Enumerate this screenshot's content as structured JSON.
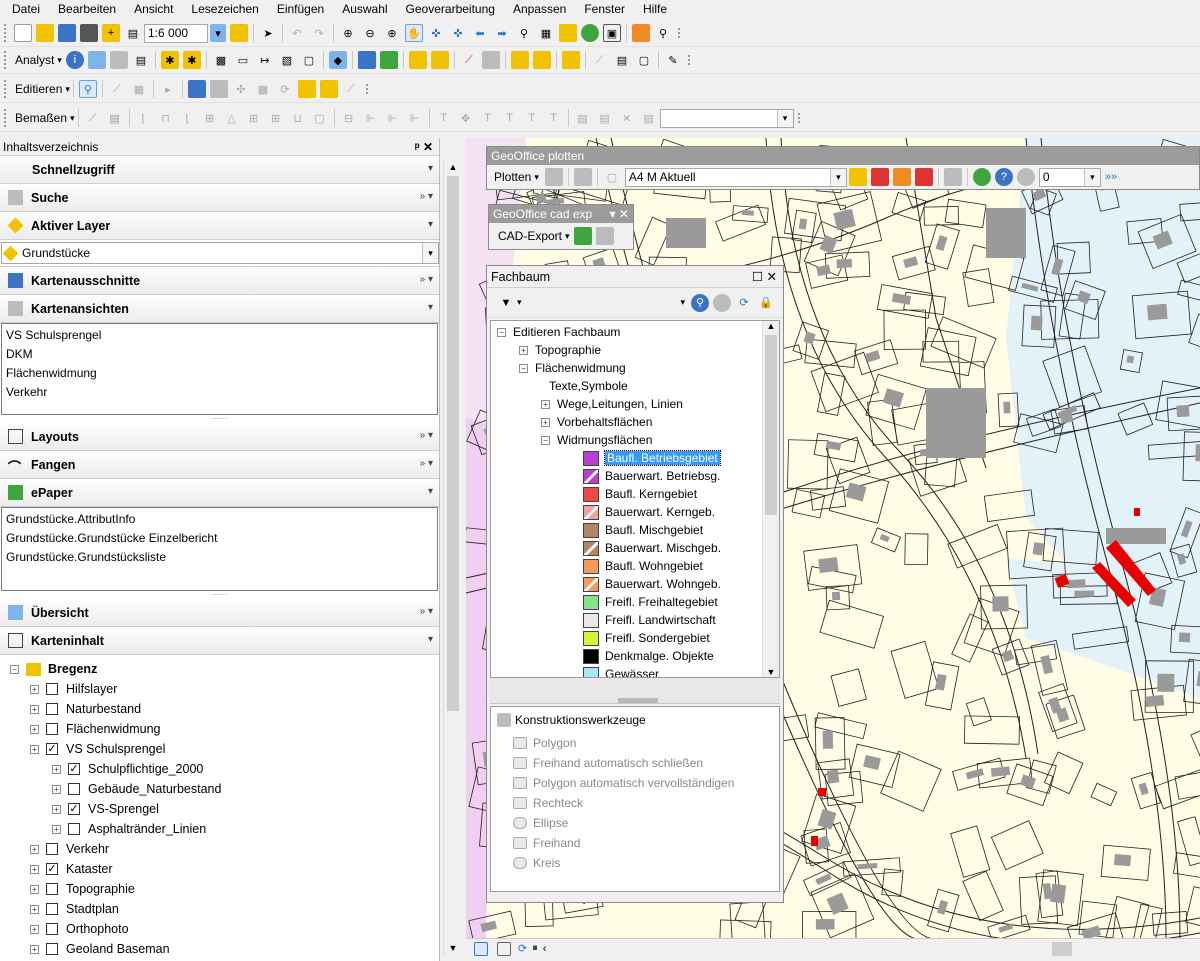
{
  "menu": [
    "Datei",
    "Bearbeiten",
    "Ansicht",
    "Lesezeichen",
    "Einfügen",
    "Auswahl",
    "Geoverarbeitung",
    "Anpassen",
    "Fenster",
    "Hilfe"
  ],
  "toolbar": {
    "scale": "1:6 000",
    "analyst": "Analyst",
    "editieren": "Editieren",
    "bemassen": "Bemaßen"
  },
  "toc": {
    "title": "Inhaltsverzeichnis",
    "pin": "ᵖ ✕",
    "schnellzugriff": "Schnellzugriff",
    "suche": "Suche",
    "aktiver_layer": "Aktiver Layer",
    "aktiver_layer_value": "Grundstücke",
    "kartenausschnitte": "Kartenausschnitte",
    "kartenansichten": "Kartenansichten",
    "kartenansichten_items": [
      "VS Schulsprengel",
      "DKM",
      "Flächenwidmung",
      "Verkehr"
    ],
    "layouts": "Layouts",
    "fangen": "Fangen",
    "epaper": "ePaper",
    "epaper_items": [
      "Grundstücke.AttributInfo",
      "Grundstücke.Grundstücke Einzelbericht",
      "Grundstücke.Grundstücksliste"
    ],
    "uebersicht": "Übersicht",
    "karteninhalt": "Karteninhalt",
    "root_layer": "Bregenz",
    "layers": [
      {
        "label": "Hilfslayer",
        "checked": "",
        "indent": 1
      },
      {
        "label": "Naturbestand",
        "checked": "",
        "indent": 1
      },
      {
        "label": "Flächenwidmung",
        "checked": "",
        "indent": 1
      },
      {
        "label": "VS Schulsprengel",
        "checked": "✓",
        "indent": 1
      },
      {
        "label": "Schulpflichtige_2000",
        "checked": "✓",
        "indent": 2
      },
      {
        "label": "Gebäude_Naturbestand",
        "checked": "",
        "indent": 2
      },
      {
        "label": "VS-Sprengel",
        "checked": "✓",
        "indent": 2
      },
      {
        "label": "Asphaltränder_Linien",
        "checked": "",
        "indent": 2
      },
      {
        "label": "Verkehr",
        "checked": "",
        "indent": 1
      },
      {
        "label": "Kataster",
        "checked": "✓",
        "indent": 1
      },
      {
        "label": "Topographie",
        "checked": "",
        "indent": 1
      },
      {
        "label": "Stadtplan",
        "checked": "",
        "indent": 1
      },
      {
        "label": "Orthophoto",
        "checked": "",
        "indent": 1
      },
      {
        "label": "Geoland Baseman",
        "checked": "",
        "indent": 1
      }
    ]
  },
  "plot": {
    "title": "GeoOffice plotten",
    "plotten": "Plotten",
    "format": "A4 M Aktuell",
    "value": "0"
  },
  "cad": {
    "title": "GeoOffice cad exp",
    "btn": "CAD-Export"
  },
  "fach": {
    "title": "Fachbaum",
    "root": "Editieren Fachbaum",
    "nodes": [
      "Topographie",
      "Flächenwidmung",
      "Texte,Symbole",
      "Wege,Leitungen, Linien",
      "Vorbehaltsflächen",
      "Widmungsflächen"
    ],
    "items": [
      {
        "label": "Baufl. Betriebsgebiet",
        "color": "#b63fd6",
        "hatch": "none",
        "selected": "yes"
      },
      {
        "label": "Bauerwart. Betriebsg.",
        "color": "#b63fd6",
        "hatch": "diag"
      },
      {
        "label": "Baufl. Kerngebiet",
        "color": "#f04848",
        "hatch": "none"
      },
      {
        "label": "Bauerwart. Kerngeb.",
        "color": "#f4a0a0",
        "hatch": "diag"
      },
      {
        "label": "Baufl. Mischgebiet",
        "color": "#b58563",
        "hatch": "none"
      },
      {
        "label": "Bauerwart. Mischgeb.",
        "color": "#b58563",
        "hatch": "diag"
      },
      {
        "label": "Baufl. Wohngebiet",
        "color": "#f49a5a",
        "hatch": "none"
      },
      {
        "label": "Bauerwart. Wohngeb.",
        "color": "#f49a5a",
        "hatch": "diag"
      },
      {
        "label": "Freifl. Freihaltegebiet",
        "color": "#86e386",
        "hatch": "none"
      },
      {
        "label": "Freifl. Landwirtschaft",
        "color": "#e8e8e8",
        "hatch": "none"
      },
      {
        "label": "Freifl. Sondergebiet",
        "color": "#ddf03a",
        "hatch": "none"
      },
      {
        "label": "Denkmalge. Objekte",
        "color": "#000000",
        "hatch": "none"
      },
      {
        "label": "Gewässer",
        "color": "#a8e6f2",
        "hatch": "none"
      }
    ],
    "konst_title": "Konstruktionswerkzeuge",
    "konst": [
      "Polygon",
      "Freihand automatisch schließen",
      "Polygon automatisch vervollständigen",
      "Rechteck",
      "Ellipse",
      "Freihand",
      "Kreis"
    ]
  }
}
